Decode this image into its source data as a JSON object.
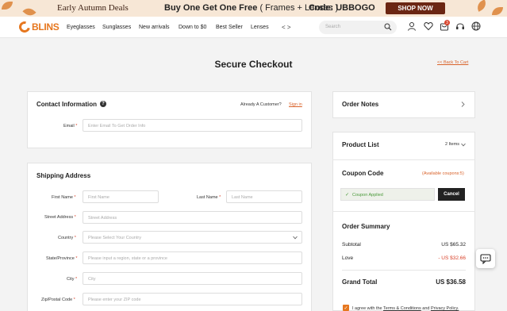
{
  "promo": {
    "title": "Early Autumn Deals",
    "offer": "Buy One Get One Free",
    "offer_detail": "( Frames + Lenses )",
    "code": "Code: UBBOGO",
    "cta": "SHOP NOW"
  },
  "nav": {
    "logo": "BLINS",
    "links": [
      "Eyeglasses",
      "Sunglasses",
      "New arrivals",
      "Down to $0",
      "Best Seller",
      "Lenses"
    ],
    "arrows": "< >",
    "search_placeholder": "Search",
    "cart_count": "3"
  },
  "page": {
    "title": "Secure Checkout",
    "back_link": "<< Back To Cart"
  },
  "contact": {
    "title": "Contact Information",
    "already_customer": "Already A Customer?",
    "sign_in": "Sign in",
    "email_label": "Email",
    "email_placeholder": "Enter Email To Get Order Info"
  },
  "shipping": {
    "title": "Shipping Address",
    "first_name_label": "First Name",
    "first_name_placeholder": "First Name",
    "last_name_label": "Last Name",
    "last_name_placeholder": "Last Name",
    "street_label": "Street Address",
    "street_placeholder": "Street Address",
    "country_label": "Country",
    "country_placeholder": "Please Select Your Country",
    "state_label": "State/Province",
    "state_placeholder": "Please input a region, state or a province",
    "city_label": "City",
    "city_placeholder": "City",
    "zip_label": "Zip/Postal Code",
    "zip_placeholder": "Please enter your ZIP code"
  },
  "order_notes": {
    "title": "Order Notes"
  },
  "product_list": {
    "title": "Product List",
    "count": "2 Items"
  },
  "coupon": {
    "title": "Coupon Code",
    "available": "(Available coupons:5)",
    "applied": "Coupon Applied",
    "cancel": "Cancel"
  },
  "summary": {
    "title": "Order Summary",
    "subtotal_label": "Subtotal",
    "subtotal_value": "US $65.32",
    "discount_label": "Love",
    "discount_value": "- US $32.66",
    "grand_label": "Grand Total",
    "grand_value": "US $36.58"
  },
  "agree": {
    "prefix": "I agree with the ",
    "terms": "Terms & Conditions",
    "and": " and ",
    "privacy": "Privacy Policy."
  },
  "colors": {
    "accent": "#e6771f",
    "banner_btn": "#6b2613",
    "success": "#4a9a3a",
    "required": "#d9432b"
  }
}
